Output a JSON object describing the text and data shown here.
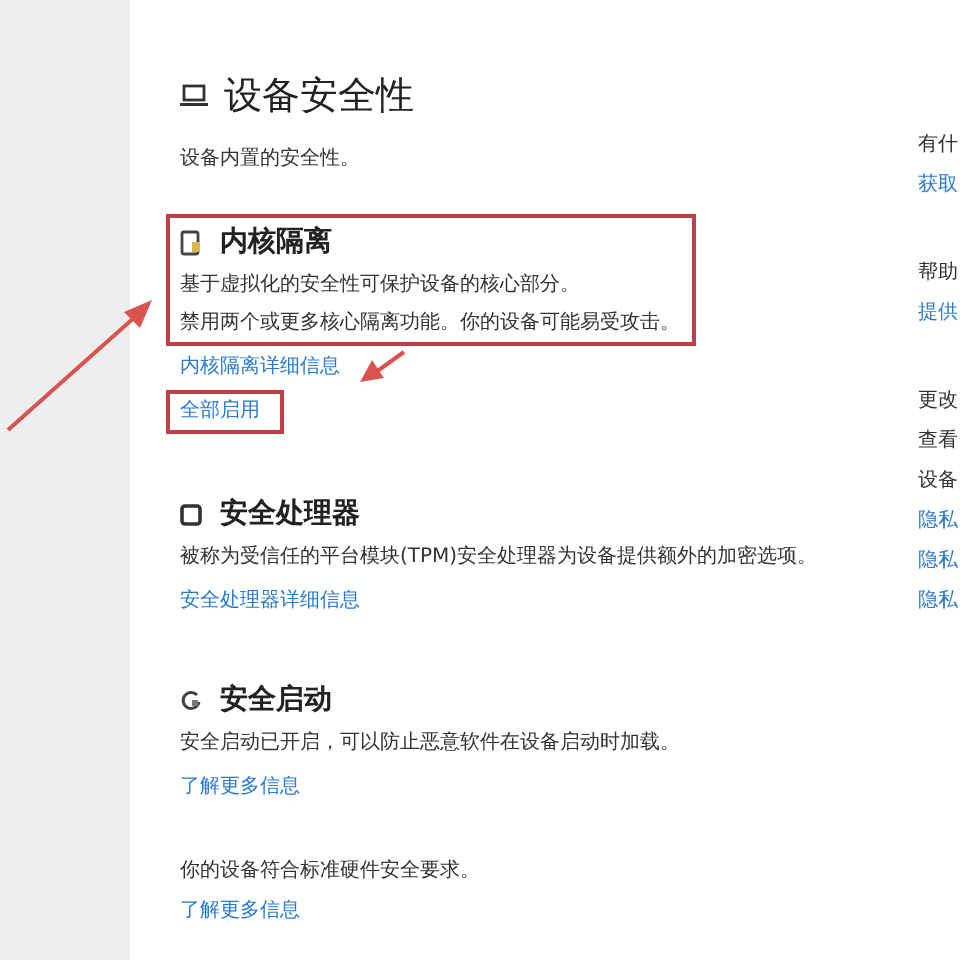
{
  "page": {
    "title": "设备安全性",
    "subtitle": "设备内置的安全性。"
  },
  "sections": [
    {
      "title": "内核隔离",
      "lines": [
        "基于虚拟化的安全性可保护设备的核心部分。",
        "禁用两个或更多核心隔离功能。你的设备可能易受攻击。"
      ],
      "highlighted": true,
      "links": [
        {
          "label": "内核隔离详细信息",
          "highlighted": false
        },
        {
          "label": "全部启用",
          "highlighted": true
        }
      ]
    },
    {
      "title": "安全处理器",
      "lines": [
        "被称为受信任的平台模块(TPM)安全处理器为设备提供额外的加密选项。"
      ],
      "highlighted": false,
      "links": [
        {
          "label": "安全处理器详细信息",
          "highlighted": false
        }
      ]
    },
    {
      "title": "安全启动",
      "lines": [
        "安全启动已开启，可以防止恶意软件在设备启动时加载。"
      ],
      "highlighted": false,
      "links": [
        {
          "label": "了解更多信息",
          "highlighted": false
        }
      ]
    }
  ],
  "compliance": {
    "text": "你的设备符合标准硬件安全要求。",
    "link": "了解更多信息"
  },
  "side_panel": [
    {
      "kind": "heading",
      "text": "有什"
    },
    {
      "kind": "link",
      "text": "获取"
    },
    {
      "kind": "heading",
      "text": "帮助"
    },
    {
      "kind": "link",
      "text": "提供"
    },
    {
      "kind": "heading",
      "text": "更改"
    },
    {
      "kind": "text",
      "text": "查看"
    },
    {
      "kind": "text",
      "text": "设备"
    },
    {
      "kind": "link",
      "text": "隐私"
    },
    {
      "kind": "link",
      "text": "隐私"
    },
    {
      "kind": "link",
      "text": "隐私"
    }
  ]
}
